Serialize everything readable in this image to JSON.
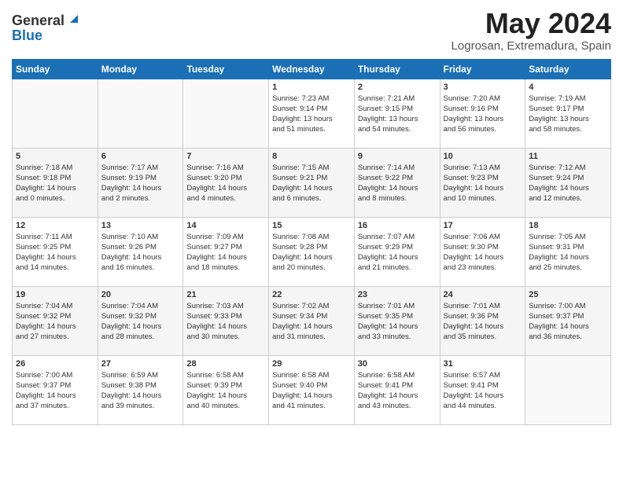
{
  "header": {
    "logo_general": "General",
    "logo_blue": "Blue",
    "month_title": "May 2024",
    "location": "Logrosan, Extremadura, Spain"
  },
  "days_of_week": [
    "Sunday",
    "Monday",
    "Tuesday",
    "Wednesday",
    "Thursday",
    "Friday",
    "Saturday"
  ],
  "weeks": [
    [
      {
        "day": "",
        "info": ""
      },
      {
        "day": "",
        "info": ""
      },
      {
        "day": "",
        "info": ""
      },
      {
        "day": "1",
        "info": "Sunrise: 7:23 AM\nSunset: 9:14 PM\nDaylight: 13 hours\nand 51 minutes."
      },
      {
        "day": "2",
        "info": "Sunrise: 7:21 AM\nSunset: 9:15 PM\nDaylight: 13 hours\nand 54 minutes."
      },
      {
        "day": "3",
        "info": "Sunrise: 7:20 AM\nSunset: 9:16 PM\nDaylight: 13 hours\nand 56 minutes."
      },
      {
        "day": "4",
        "info": "Sunrise: 7:19 AM\nSunset: 9:17 PM\nDaylight: 13 hours\nand 58 minutes."
      }
    ],
    [
      {
        "day": "5",
        "info": "Sunrise: 7:18 AM\nSunset: 9:18 PM\nDaylight: 14 hours\nand 0 minutes."
      },
      {
        "day": "6",
        "info": "Sunrise: 7:17 AM\nSunset: 9:19 PM\nDaylight: 14 hours\nand 2 minutes."
      },
      {
        "day": "7",
        "info": "Sunrise: 7:16 AM\nSunset: 9:20 PM\nDaylight: 14 hours\nand 4 minutes."
      },
      {
        "day": "8",
        "info": "Sunrise: 7:15 AM\nSunset: 9:21 PM\nDaylight: 14 hours\nand 6 minutes."
      },
      {
        "day": "9",
        "info": "Sunrise: 7:14 AM\nSunset: 9:22 PM\nDaylight: 14 hours\nand 8 minutes."
      },
      {
        "day": "10",
        "info": "Sunrise: 7:13 AM\nSunset: 9:23 PM\nDaylight: 14 hours\nand 10 minutes."
      },
      {
        "day": "11",
        "info": "Sunrise: 7:12 AM\nSunset: 9:24 PM\nDaylight: 14 hours\nand 12 minutes."
      }
    ],
    [
      {
        "day": "12",
        "info": "Sunrise: 7:11 AM\nSunset: 9:25 PM\nDaylight: 14 hours\nand 14 minutes."
      },
      {
        "day": "13",
        "info": "Sunrise: 7:10 AM\nSunset: 9:26 PM\nDaylight: 14 hours\nand 16 minutes."
      },
      {
        "day": "14",
        "info": "Sunrise: 7:09 AM\nSunset: 9:27 PM\nDaylight: 14 hours\nand 18 minutes."
      },
      {
        "day": "15",
        "info": "Sunrise: 7:08 AM\nSunset: 9:28 PM\nDaylight: 14 hours\nand 20 minutes."
      },
      {
        "day": "16",
        "info": "Sunrise: 7:07 AM\nSunset: 9:29 PM\nDaylight: 14 hours\nand 21 minutes."
      },
      {
        "day": "17",
        "info": "Sunrise: 7:06 AM\nSunset: 9:30 PM\nDaylight: 14 hours\nand 23 minutes."
      },
      {
        "day": "18",
        "info": "Sunrise: 7:05 AM\nSunset: 9:31 PM\nDaylight: 14 hours\nand 25 minutes."
      }
    ],
    [
      {
        "day": "19",
        "info": "Sunrise: 7:04 AM\nSunset: 9:32 PM\nDaylight: 14 hours\nand 27 minutes."
      },
      {
        "day": "20",
        "info": "Sunrise: 7:04 AM\nSunset: 9:32 PM\nDaylight: 14 hours\nand 28 minutes."
      },
      {
        "day": "21",
        "info": "Sunrise: 7:03 AM\nSunset: 9:33 PM\nDaylight: 14 hours\nand 30 minutes."
      },
      {
        "day": "22",
        "info": "Sunrise: 7:02 AM\nSunset: 9:34 PM\nDaylight: 14 hours\nand 31 minutes."
      },
      {
        "day": "23",
        "info": "Sunrise: 7:01 AM\nSunset: 9:35 PM\nDaylight: 14 hours\nand 33 minutes."
      },
      {
        "day": "24",
        "info": "Sunrise: 7:01 AM\nSunset: 9:36 PM\nDaylight: 14 hours\nand 35 minutes."
      },
      {
        "day": "25",
        "info": "Sunrise: 7:00 AM\nSunset: 9:37 PM\nDaylight: 14 hours\nand 36 minutes."
      }
    ],
    [
      {
        "day": "26",
        "info": "Sunrise: 7:00 AM\nSunset: 9:37 PM\nDaylight: 14 hours\nand 37 minutes."
      },
      {
        "day": "27",
        "info": "Sunrise: 6:59 AM\nSunset: 9:38 PM\nDaylight: 14 hours\nand 39 minutes."
      },
      {
        "day": "28",
        "info": "Sunrise: 6:58 AM\nSunset: 9:39 PM\nDaylight: 14 hours\nand 40 minutes."
      },
      {
        "day": "29",
        "info": "Sunrise: 6:58 AM\nSunset: 9:40 PM\nDaylight: 14 hours\nand 41 minutes."
      },
      {
        "day": "30",
        "info": "Sunrise: 6:58 AM\nSunset: 9:41 PM\nDaylight: 14 hours\nand 43 minutes."
      },
      {
        "day": "31",
        "info": "Sunrise: 6:57 AM\nSunset: 9:41 PM\nDaylight: 14 hours\nand 44 minutes."
      },
      {
        "day": "",
        "info": ""
      }
    ]
  ]
}
